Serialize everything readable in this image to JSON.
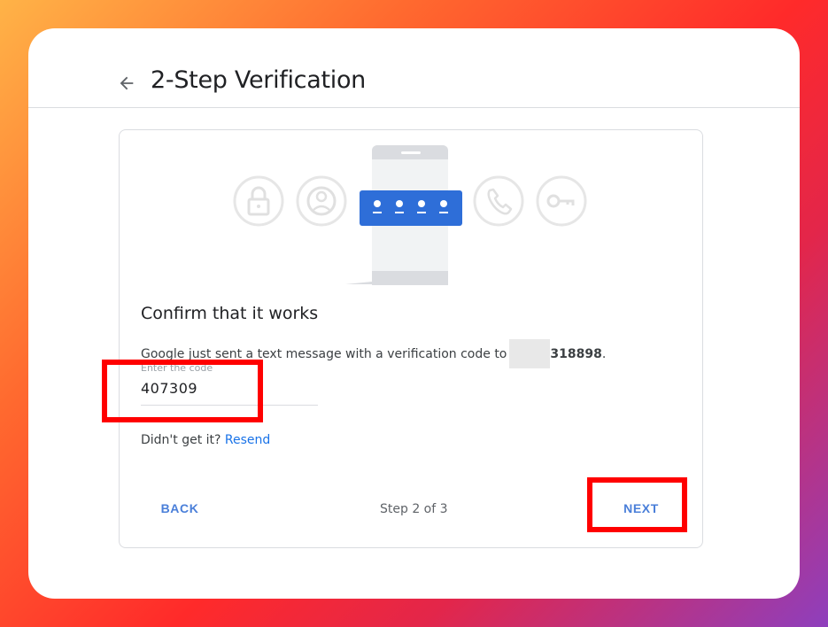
{
  "header": {
    "title": "2-Step Verification"
  },
  "card": {
    "heading": "Confirm that it works",
    "message_prefix": "Google just sent a text message with a verification code to",
    "phone_tail": "318898",
    "message_suffix": ".",
    "code_field": {
      "label": "Enter the code",
      "value": "407309"
    },
    "resend_prompt": "Didn't get it?",
    "resend_link": "Resend",
    "back_label": "BACK",
    "step_text": "Step 2 of 3",
    "next_label": "NEXT"
  },
  "colors": {
    "accent": "#4a7fd9",
    "link": "#1a73e8",
    "highlight": "#ff0000",
    "code_badge": "#2e6ed8"
  },
  "icons": [
    "back-arrow-icon",
    "lock-icon",
    "account-icon",
    "phone-with-code-icon",
    "phone-call-icon",
    "key-icon"
  ]
}
